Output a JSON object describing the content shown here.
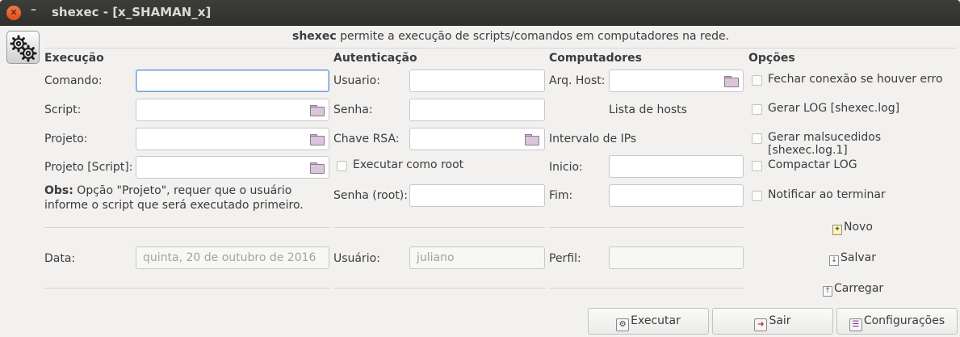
{
  "window": {
    "title": "shexec - [x_SHAMAN_x]",
    "close_glyph": "✕",
    "minimize_glyph": "–"
  },
  "intro": {
    "bold": "shexec",
    "text": " permite a execução de scripts/comandos em computadores na rede."
  },
  "execucao": {
    "header": "Execução",
    "comando_label": "Comando:",
    "comando_value": "",
    "script_label": "Script:",
    "script_value": "",
    "projeto_label": "Projeto:",
    "projeto_value": "",
    "projeto_script_label": "Projeto [Script]:",
    "projeto_script_value": "",
    "obs_bold": "Obs:",
    "obs_text": " Opção \"Projeto\", requer que o usuário informe o script que será executado primeiro.",
    "data_label": "Data:",
    "data_value": "quinta, 20 de outubro de 2016"
  },
  "autenticacao": {
    "header": "Autenticação",
    "usuario_label": "Usuario:",
    "usuario_value": "",
    "senha_label": "Senha:",
    "senha_value": "",
    "chave_label": "Chave RSA:",
    "chave_value": "",
    "root_label": "Executar como root",
    "senha_root_label": "Senha (root):",
    "senha_root_value": "",
    "usuario2_label": "Usuário:",
    "usuario2_value": "juliano"
  },
  "computadores": {
    "header": "Computadores",
    "arq_host_label": "Arq. Host:",
    "arq_host_value": "",
    "lista_hosts": "Lista de hosts",
    "intervalo": "Intervalo de IPs",
    "inicio_label": "Inicio:",
    "inicio_value": "",
    "fim_label": "Fim:",
    "fim_value": "",
    "perfil_label": "Perfil:",
    "perfil_value": ""
  },
  "opcoes": {
    "header": "Opções",
    "items": [
      {
        "label": "Fechar conexão se houver erro",
        "checked": false
      },
      {
        "label": "Gerar LOG [shexec.log]",
        "checked": false
      },
      {
        "label": "Gerar malsucedidos [shexec.log.1]",
        "checked": false
      },
      {
        "label": "Compactar LOG",
        "checked": false
      },
      {
        "label": "Notificar ao terminar",
        "checked": false
      }
    ],
    "novo": "Novo",
    "salvar": "Salvar",
    "carregar": "Carregar"
  },
  "buttons": {
    "executar": "Executar",
    "sair": "Sair",
    "configuracoes": "Configurações"
  },
  "colors": {
    "titlebar": "#3d3d3a",
    "close": "#e34c19",
    "focus": "#6e9fd7",
    "background": "#f2f1f0"
  },
  "icons": [
    "close-icon",
    "minimize-icon",
    "gears-icon",
    "folder-icon",
    "new-file-icon",
    "save-icon",
    "load-icon",
    "run-icon",
    "exit-icon",
    "settings-icon"
  ]
}
